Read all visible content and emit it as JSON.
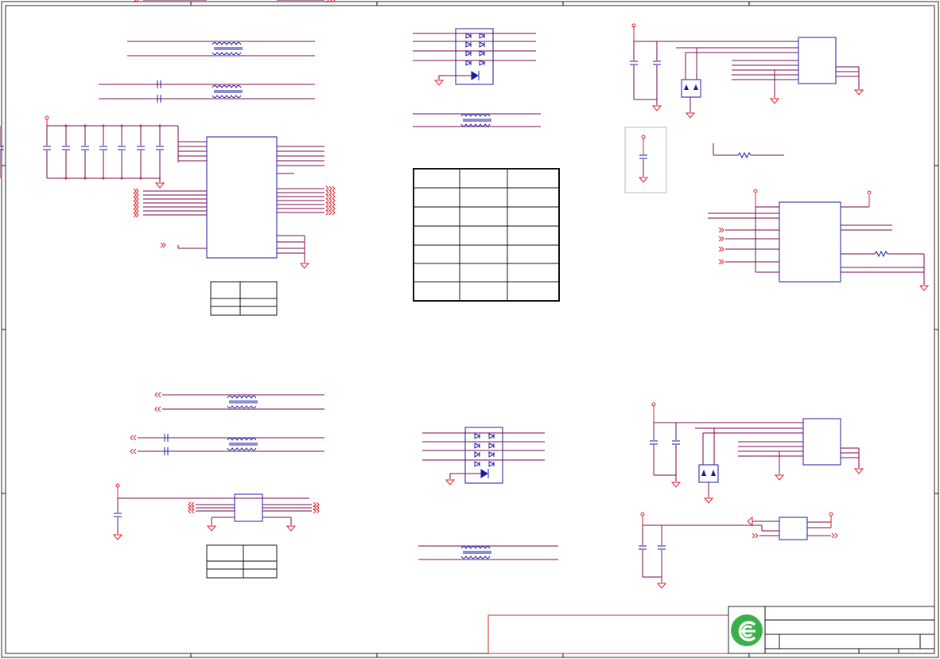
{
  "diagram": {
    "kind": "electrical-schematic",
    "colors": {
      "wire": "#7a0a52",
      "power_wire": "#e0202a",
      "component": "#1a1aa8",
      "border": "#222222",
      "table_border": "#111111",
      "logo_green": "#3ab04a"
    },
    "title_block": {
      "logo_icon": "green-circle-logo-icon"
    }
  }
}
